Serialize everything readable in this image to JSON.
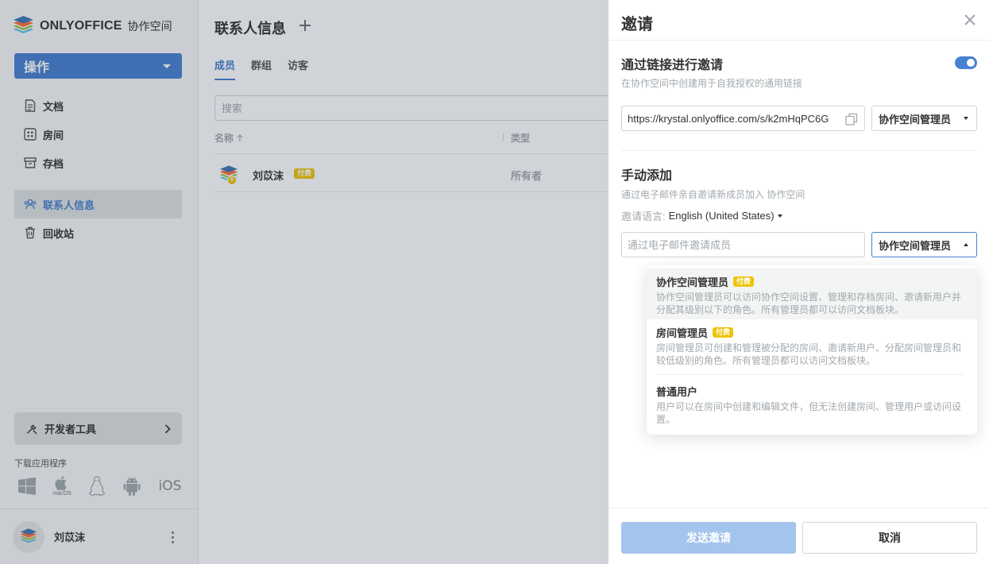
{
  "app": {
    "brand": "ONLYOFFICE",
    "product": "协作空间"
  },
  "sidebar": {
    "action_label": "操作",
    "items": [
      {
        "label": "文档",
        "icon": "document-icon"
      },
      {
        "label": "房间",
        "icon": "rooms-icon"
      },
      {
        "label": "存档",
        "icon": "archive-icon"
      },
      {
        "label": "联系人信息",
        "icon": "contacts-icon",
        "active": true
      },
      {
        "label": "回收站",
        "icon": "trash-icon"
      }
    ],
    "dev_tools_label": "开发者工具",
    "download_label": "下载应用程序",
    "download_icons": [
      "windows-icon",
      "macos-icon",
      "linux-icon",
      "android-icon",
      "ios-icon"
    ],
    "macos_caption": "macOS",
    "ios_caption": "iOS",
    "profile_name": "刘苡沫"
  },
  "main": {
    "title": "联系人信息",
    "tabs": [
      {
        "label": "成员",
        "active": true
      },
      {
        "label": "群组"
      },
      {
        "label": "访客"
      }
    ],
    "search_placeholder": "搜索",
    "columns": {
      "name": "名称",
      "type": "类型"
    },
    "rows": [
      {
        "name": "刘苡沫",
        "badge": "付费",
        "type": "所有者",
        "avatar_badge": "0"
      }
    ]
  },
  "invite": {
    "title": "邀请",
    "link_section": {
      "title": "通过链接进行邀请",
      "description": "在协作空间中创建用于自我授权的通用链接",
      "enabled": true,
      "link": "https://krystal.onlyoffice.com/s/k2mHqPC6G",
      "role": "协作空间管理员"
    },
    "manual_section": {
      "title": "手动添加",
      "description": "通过电子邮件亲自邀请新成员加入 协作空间",
      "language_label": "邀请语言:",
      "language_value": "English (United States)",
      "email_placeholder": "通过电子邮件邀请成员",
      "role": "协作空间管理员"
    },
    "role_options": [
      {
        "title": "协作空间管理员",
        "badge": "付费",
        "description": "协作空间管理员可以访问协作空间设置、管理和存档房间、邀请新用户并分配其级别以下的角色。所有管理员都可以访问文档板块。",
        "selected": true
      },
      {
        "title": "房间管理员",
        "badge": "付费",
        "description": "房间管理员可创建和管理被分配的房间、邀请新用户、分配房间管理员和较低级别的角色。所有管理员都可以访问文档板块。"
      },
      {
        "title": "普通用户",
        "badge": "",
        "description": "用户可以在房间中创建和编辑文件，但无法创建房间、管理用户或访问设置。"
      }
    ],
    "send_label": "发送邀请",
    "cancel_label": "取消"
  },
  "colors": {
    "accent": "#4781d1",
    "paid_badge": "#edc409",
    "send_disabled": "#a3c4ec"
  }
}
